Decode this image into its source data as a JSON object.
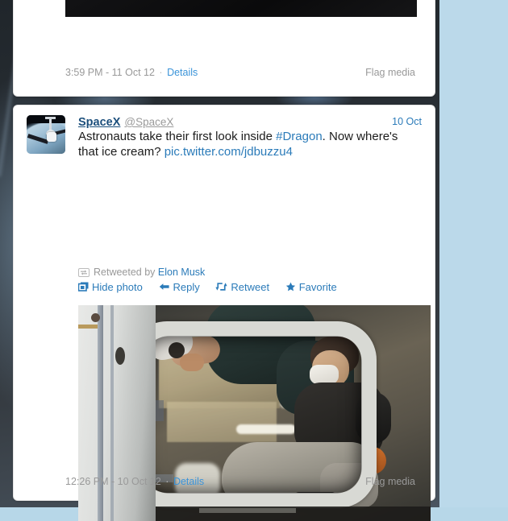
{
  "background": {
    "desktop_color": "#bbd9ea",
    "strip_color": "#d3e5f0"
  },
  "tweets": [
    {
      "id": "tweet-top",
      "media": {
        "type": "video-still",
        "alt_name": "dark-launch-still"
      },
      "footer": {
        "timestamp": "3:59 PM - 11 Oct 12",
        "separator": "·",
        "details_label": "Details",
        "flag_label": "Flag media"
      }
    },
    {
      "id": "tweet-main",
      "author": {
        "display_name": "SpaceX",
        "handle": "@SpaceX",
        "avatar_name": "spacex-dragon-avatar"
      },
      "date": "10 Oct",
      "text": {
        "before_hashtag": "Astronauts take their first look inside ",
        "hashtag": "#Dragon",
        "after_hashtag": ". Now where's that ice cream? ",
        "url": "pic.twitter.com/jdbuzzu4"
      },
      "retweet_context": {
        "prefix": "Retweeted by ",
        "user": "Elon Musk",
        "icon": "retweet-icon"
      },
      "actions": [
        {
          "name": "hide-photo",
          "label": "Hide photo",
          "icon": "photo-icon"
        },
        {
          "name": "reply",
          "label": "Reply",
          "icon": "reply-arrow-icon"
        },
        {
          "name": "retweet",
          "label": "Retweet",
          "icon": "retweet-icon"
        },
        {
          "name": "favorite",
          "label": "Favorite",
          "icon": "star-icon"
        }
      ],
      "photo": {
        "alt_name": "astronauts-inside-dragon-capsule"
      },
      "footer": {
        "timestamp": "12:26 PM - 10 Oct 12",
        "separator": "·",
        "details_label": "Details",
        "flag_label": "Flag media"
      }
    }
  ],
  "colors": {
    "link": "#2b7bb9",
    "muted": "#999999",
    "name": "#1c4f7c",
    "card_bg": "#ffffff"
  }
}
